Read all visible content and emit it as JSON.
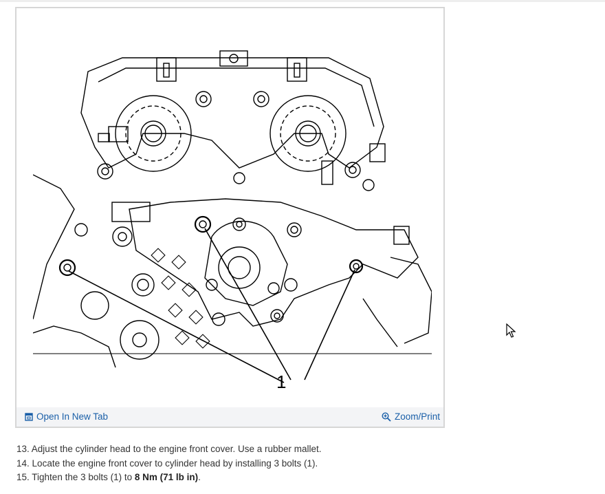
{
  "figure": {
    "callout_label": "1",
    "open_tab_label": "Open In New Tab",
    "zoom_label": "Zoom/Print",
    "icons": {
      "open_tab": "open-new-tab-icon",
      "zoom": "zoom-in-icon"
    }
  },
  "steps": [
    {
      "num": "13.",
      "text": "Adjust the cylinder head to the engine front cover. Use a rubber mallet."
    },
    {
      "num": "14.",
      "text": "Locate the engine front cover to cylinder head by installing 3 bolts (1)."
    },
    {
      "num": "15.",
      "text_before": "Tighten the 3 bolts (1) to ",
      "torque": "8 Nm (71 lb in)",
      "text_after": "."
    }
  ],
  "colors": {
    "link": "#1a5fa8",
    "toolbar_bg": "#f3f4f6",
    "border": "#d6d6d6",
    "text": "#333333"
  }
}
